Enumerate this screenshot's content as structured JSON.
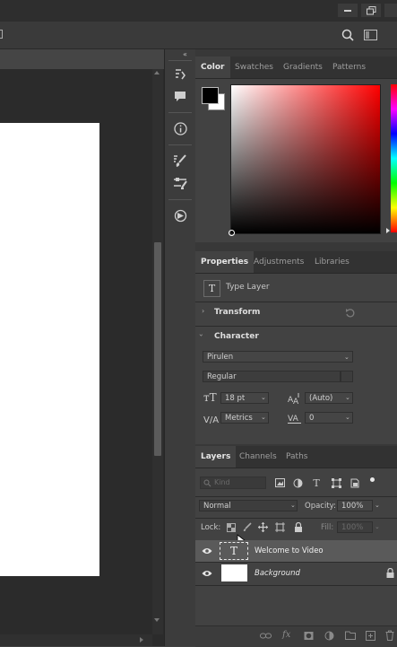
{
  "panels": {
    "color_tabs": [
      "Color",
      "Swatches",
      "Gradients",
      "Patterns"
    ],
    "properties_tabs": [
      "Properties",
      "Adjustments",
      "Libraries"
    ],
    "layers_tabs": [
      "Layers",
      "Channels",
      "Paths"
    ]
  },
  "properties": {
    "layer_type": "Type Layer",
    "transform_label": "Transform",
    "character_label": "Character",
    "font_family": "Pirulen",
    "font_style": "Regular",
    "font_size": "18 pt",
    "leading": "(Auto)",
    "kerning": "Metrics",
    "tracking": "0"
  },
  "layers": {
    "search_placeholder": "Kind",
    "blend_mode": "Normal",
    "opacity_label": "Opacity:",
    "opacity_value": "100%",
    "lock_label": "Lock:",
    "fill_label": "Fill:",
    "fill_value": "100%",
    "items": [
      {
        "name": "Welcome to Video",
        "thumb_glyph": "T",
        "selected": true
      },
      {
        "name": "Background",
        "thumb_glyph": "",
        "selected": false,
        "locked": true
      }
    ]
  },
  "colors": {
    "foreground": "#000000",
    "background": "#ffffff",
    "picker_hue": "#ff0000"
  },
  "icons": {
    "window_controls": [
      "minimize-icon",
      "restore-icon"
    ],
    "option_bar": [
      "search-icon",
      "workspace-icon"
    ],
    "collapse": "collapse-panels-icon",
    "strip": [
      "history-icon",
      "comments-icon",
      "info-icon",
      "brush-settings-icon",
      "adjust-presets-icon",
      "navigator-icon"
    ]
  }
}
